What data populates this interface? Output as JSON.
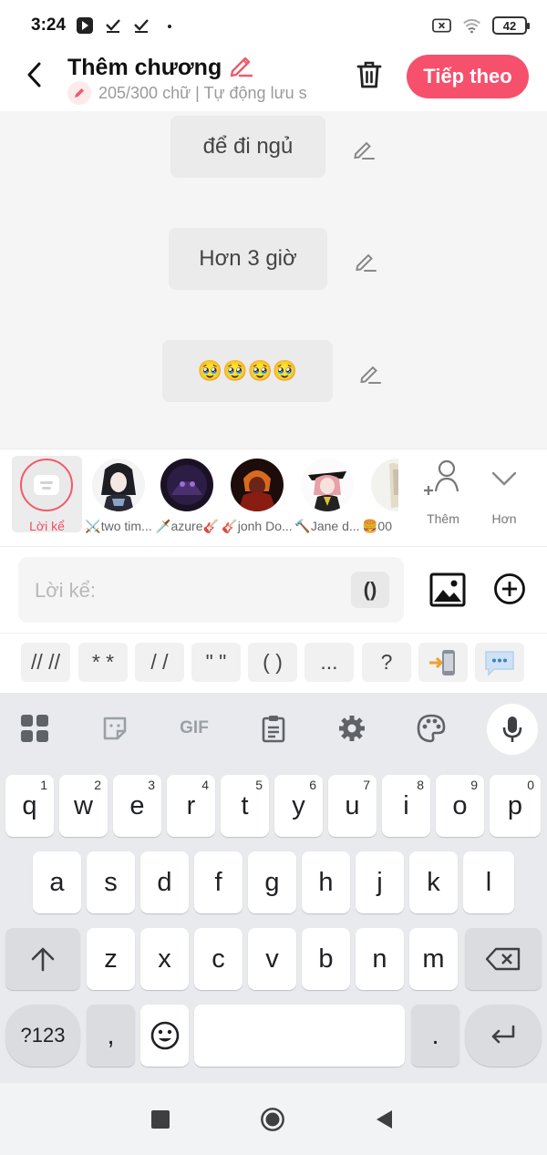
{
  "status_bar": {
    "time": "3:24",
    "battery": "42"
  },
  "header": {
    "title": "Thêm chương",
    "subtitle": "205/300 chữ | Tự động lưu s",
    "next_label": "Tiếp theo"
  },
  "messages": [
    {
      "text": "để đi ngủ"
    },
    {
      "text": "Hơn 3 giờ"
    },
    {
      "text": "🥹🥹🥹🥹"
    }
  ],
  "characters": {
    "narrator_label": "Lời kể",
    "items": [
      {
        "name": "⚔️two tim..."
      },
      {
        "name": "🗡️azure🎸"
      },
      {
        "name": "🎸jonh Do..."
      },
      {
        "name": "🔨Jane d..."
      },
      {
        "name": "🍔00"
      }
    ],
    "add_label": "Thêm",
    "more_label": "Hơn"
  },
  "input": {
    "placeholder": "Lời kể:",
    "paren_label": "()"
  },
  "quick_symbols": [
    "// //",
    "* *",
    "/ /",
    "\" \"",
    "( )",
    "...",
    "?"
  ],
  "keyboard": {
    "tools": {
      "gif_label": "GIF"
    },
    "row1": [
      {
        "key": "q",
        "hint": "1"
      },
      {
        "key": "w",
        "hint": "2"
      },
      {
        "key": "e",
        "hint": "3"
      },
      {
        "key": "r",
        "hint": "4"
      },
      {
        "key": "t",
        "hint": "5"
      },
      {
        "key": "y",
        "hint": "6"
      },
      {
        "key": "u",
        "hint": "7"
      },
      {
        "key": "i",
        "hint": "8"
      },
      {
        "key": "o",
        "hint": "9"
      },
      {
        "key": "p",
        "hint": "0"
      }
    ],
    "row2": [
      "a",
      "s",
      "d",
      "f",
      "g",
      "h",
      "j",
      "k",
      "l"
    ],
    "row3": [
      "z",
      "x",
      "c",
      "v",
      "b",
      "n",
      "m"
    ],
    "symbols_label": "?123",
    "comma": ",",
    "period": "."
  }
}
